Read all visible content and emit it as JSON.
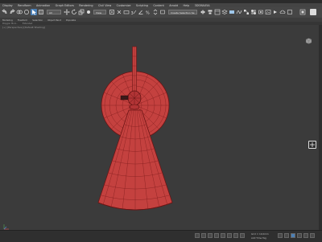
{
  "menu": [
    "Display",
    "Rendform",
    "Animation",
    "Graph Editors",
    "Rendering",
    "Civil View",
    "Customize",
    "Scripting",
    "Content",
    "Arnold",
    "Help",
    "3DSMAX5A"
  ],
  "toolbar": {
    "selection_filter": "All",
    "view_dropdown": "View",
    "named_selection": "Create Selection Se"
  },
  "ribbon": [
    "Modeling",
    "Freeform",
    "Selection",
    "Object Paint",
    "Populate"
  ],
  "ribbon_sub": [
    "Polygon Mod...",
    "Extended"
  ],
  "viewport": {
    "label": "[+] [Perspective] [Default Shading]",
    "model_color": "#c0393a",
    "wire_color": "#6b1414"
  },
  "statusbar": {
    "grid_readout": "Grid = 10,0mm",
    "time_tag_label": "Add Time Tag",
    "set_key_label": "Set Key"
  }
}
